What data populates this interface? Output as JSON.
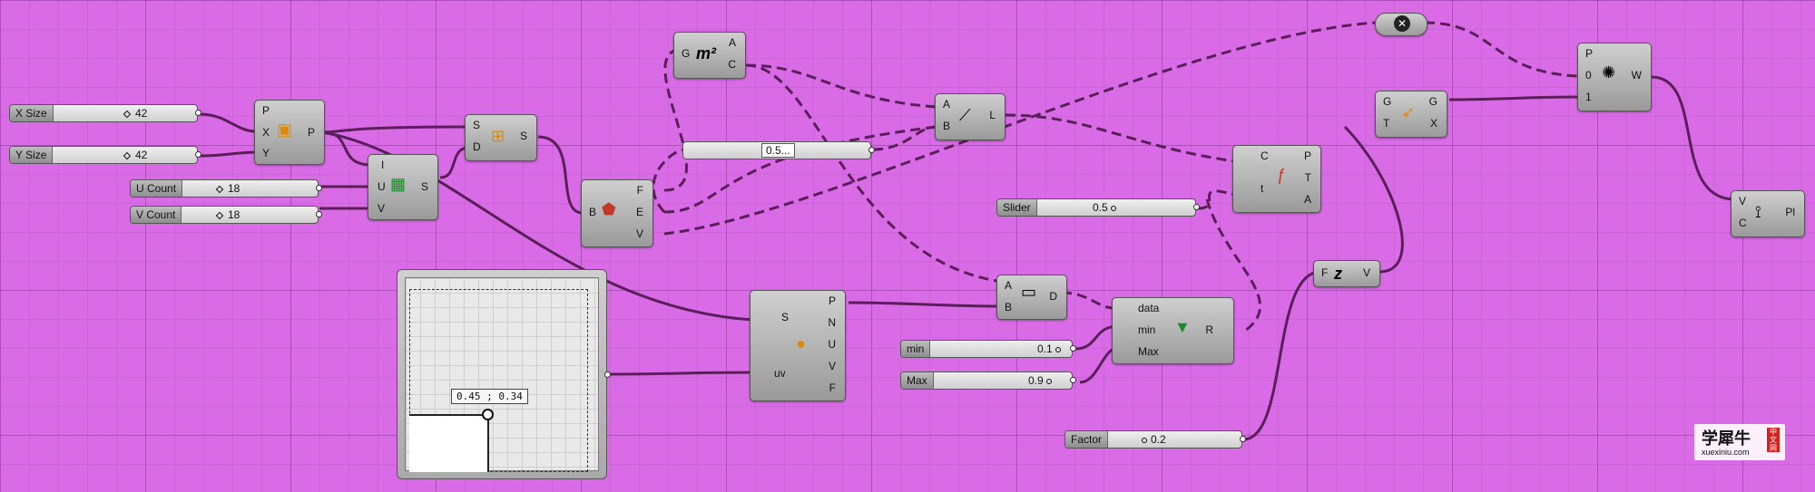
{
  "sliders": {
    "x_size": {
      "label": "X Size",
      "value": "42"
    },
    "y_size": {
      "label": "Y Size",
      "value": "42"
    },
    "u_count": {
      "label": "U Count",
      "value": "18"
    },
    "v_count": {
      "label": "V Count",
      "value": "18"
    },
    "slider": {
      "label": "Slider",
      "value": "0.5"
    },
    "min": {
      "label": "min",
      "value": "0.1"
    },
    "max": {
      "label": "Max",
      "value": "0.9"
    },
    "factor": {
      "label": "Factor",
      "value": "0.2"
    },
    "unnamed": {
      "value": "0.5..."
    }
  },
  "md_slider": {
    "readout": "0.45 ; 0.34"
  },
  "components": {
    "plane": {
      "inputs": [
        "P",
        "X",
        "Y"
      ],
      "outputs": [
        "P"
      ]
    },
    "rectangle": {
      "inputs": [
        "I",
        "U",
        "V"
      ],
      "outputs": [
        "S"
      ]
    },
    "divide": {
      "inputs": [
        "S",
        "D"
      ],
      "outputs": [
        "S"
      ]
    },
    "brep": {
      "inputs": [
        "B"
      ],
      "outputs": [
        "F",
        "E",
        "V"
      ]
    },
    "area": {
      "inputs": [
        "G"
      ],
      "outputs": [
        "A",
        "C"
      ]
    },
    "line": {
      "inputs": [
        "A",
        "B"
      ],
      "outputs": [
        "L"
      ]
    },
    "eval_surface": {
      "inputs": [
        "S",
        "uv"
      ],
      "outputs": [
        "P",
        "N",
        "U",
        "V",
        "F"
      ]
    },
    "distance": {
      "inputs": [
        "A",
        "B"
      ],
      "outputs": [
        "D"
      ]
    },
    "remap": {
      "inputs": [
        "data",
        "min",
        "Max"
      ],
      "outputs": [
        "R"
      ]
    },
    "eval_curve": {
      "inputs": [
        "C",
        "t"
      ],
      "outputs": [
        "P",
        "T",
        "A"
      ]
    },
    "move": {
      "inputs": [
        "G",
        "T"
      ],
      "outputs": [
        "G",
        "X"
      ]
    },
    "unit_z": {
      "inputs": [
        "F"
      ],
      "outputs": [
        "V"
      ]
    },
    "orient": {
      "inputs": [
        "P",
        "0",
        "1"
      ],
      "outputs": [
        "W"
      ]
    },
    "polyline": {
      "inputs": [
        "V",
        "C"
      ],
      "outputs": [
        "Pl"
      ]
    }
  },
  "watermark": {
    "text": "学犀牛",
    "sub": "xuexiniu.com",
    "badge": "中文网"
  },
  "colors": {
    "canvas": "#d96ce6",
    "wire": "#5a1f5a"
  }
}
